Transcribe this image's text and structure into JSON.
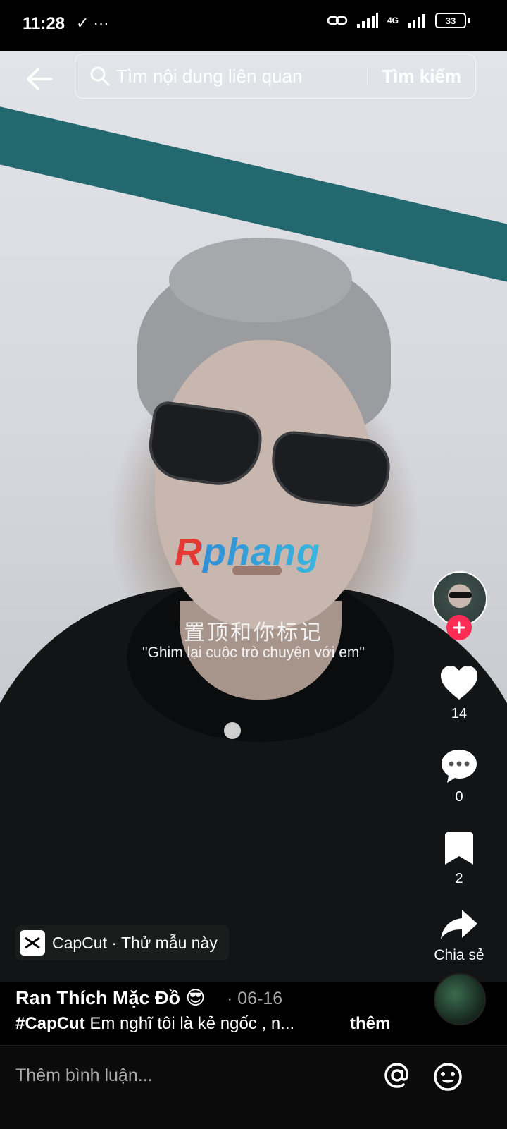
{
  "status_bar": {
    "time": "11:28",
    "left_icons": "✓ ···",
    "network": "4G",
    "battery": "33"
  },
  "search": {
    "placeholder": "Tìm nội dung liên quan",
    "button_label": "Tìm kiếm"
  },
  "video": {
    "watermark": "Rphang",
    "caption_chinese": "置顶和你标记",
    "caption_vietnamese": "\"Ghim lại cuộc trò chuyện với em\""
  },
  "actions": {
    "likes": "14",
    "comments": "0",
    "saves": "2",
    "share_label": "Chia sẻ"
  },
  "capcut": {
    "label": "CapCut · Thử mẫu này"
  },
  "post": {
    "author": "Ran Thích Mặc Đồ 😎",
    "date": "· 06-16",
    "hashtag": "#CapCut",
    "description": " Em nghĩ tôi là kẻ ngốc , n...",
    "more_label": "thêm"
  },
  "comment_bar": {
    "placeholder": "Thêm bình luận..."
  },
  "colors": {
    "accent": "#fe2c55",
    "teal": "#23686f"
  }
}
